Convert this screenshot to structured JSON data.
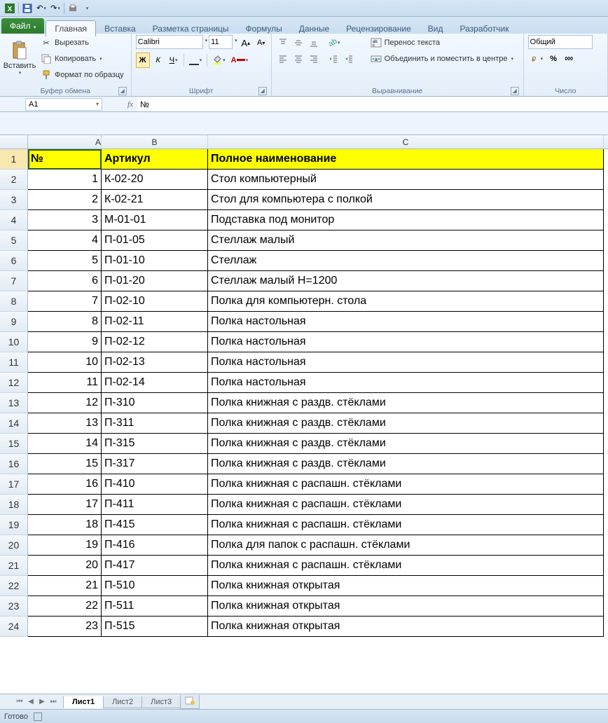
{
  "qat": {
    "save": "💾",
    "undo": "↶",
    "redo": "↷"
  },
  "file_tab": "Файл",
  "tabs": [
    "Главная",
    "Вставка",
    "Разметка страницы",
    "Формулы",
    "Данные",
    "Рецензирование",
    "Вид",
    "Разработчик"
  ],
  "active_tab": 0,
  "ribbon": {
    "clipboard": {
      "paste": "Вставить",
      "cut": "Вырезать",
      "copy": "Копировать",
      "format_painter": "Формат по образцу",
      "label": "Буфер обмена"
    },
    "font": {
      "name": "Calibri",
      "size": "11",
      "label": "Шрифт"
    },
    "alignment": {
      "wrap": "Перенос текста",
      "merge": "Объединить и поместить в центре",
      "label": "Выравнивание"
    },
    "number": {
      "format": "Общий",
      "label": "Число"
    }
  },
  "name_box": "A1",
  "formula": "№",
  "columns": [
    "A",
    "B",
    "C"
  ],
  "headers": [
    "№",
    "Артикул",
    "Полное наименование"
  ],
  "rows": [
    {
      "n": "1",
      "art": "К-02-20",
      "name": "Стол компьютерный"
    },
    {
      "n": "2",
      "art": "К-02-21",
      "name": "Стол для компьютера с полкой"
    },
    {
      "n": "3",
      "art": "М-01-01",
      "name": "Подставка под монитор"
    },
    {
      "n": "4",
      "art": "П-01-05",
      "name": "Стеллаж малый"
    },
    {
      "n": "5",
      "art": "П-01-10",
      "name": "Стеллаж"
    },
    {
      "n": "6",
      "art": "П-01-20",
      "name": "Стеллаж малый Н=1200"
    },
    {
      "n": "7",
      "art": "П-02-10",
      "name": "Полка для компьютерн. стола"
    },
    {
      "n": "8",
      "art": "П-02-11",
      "name": "Полка настольная"
    },
    {
      "n": "9",
      "art": "П-02-12",
      "name": "Полка настольная"
    },
    {
      "n": "10",
      "art": "П-02-13",
      "name": "Полка настольная"
    },
    {
      "n": "11",
      "art": "П-02-14",
      "name": "Полка настольная"
    },
    {
      "n": "12",
      "art": "П-310",
      "name": "Полка книжная с раздв. стёклами"
    },
    {
      "n": "13",
      "art": "П-311",
      "name": "Полка книжная с раздв. стёклами"
    },
    {
      "n": "14",
      "art": "П-315",
      "name": "Полка книжная с раздв. стёклами"
    },
    {
      "n": "15",
      "art": "П-317",
      "name": "Полка книжная с раздв. стёклами"
    },
    {
      "n": "16",
      "art": "П-410",
      "name": "Полка книжная с распашн. стёклами"
    },
    {
      "n": "17",
      "art": "П-411",
      "name": "Полка книжная с распашн. стёклами"
    },
    {
      "n": "18",
      "art": "П-415",
      "name": "Полка книжная с распашн. стёклами"
    },
    {
      "n": "19",
      "art": "П-416",
      "name": "Полка для папок с распашн. стёклами"
    },
    {
      "n": "20",
      "art": "П-417",
      "name": "Полка книжная с распашн. стёклами"
    },
    {
      "n": "21",
      "art": "П-510",
      "name": "Полка книжная открытая"
    },
    {
      "n": "22",
      "art": "П-511",
      "name": "Полка книжная открытая"
    },
    {
      "n": "23",
      "art": "П-515",
      "name": "Полка книжная открытая"
    }
  ],
  "sheets": [
    "Лист1",
    "Лист2",
    "Лист3"
  ],
  "active_sheet": 0,
  "status": "Готово"
}
